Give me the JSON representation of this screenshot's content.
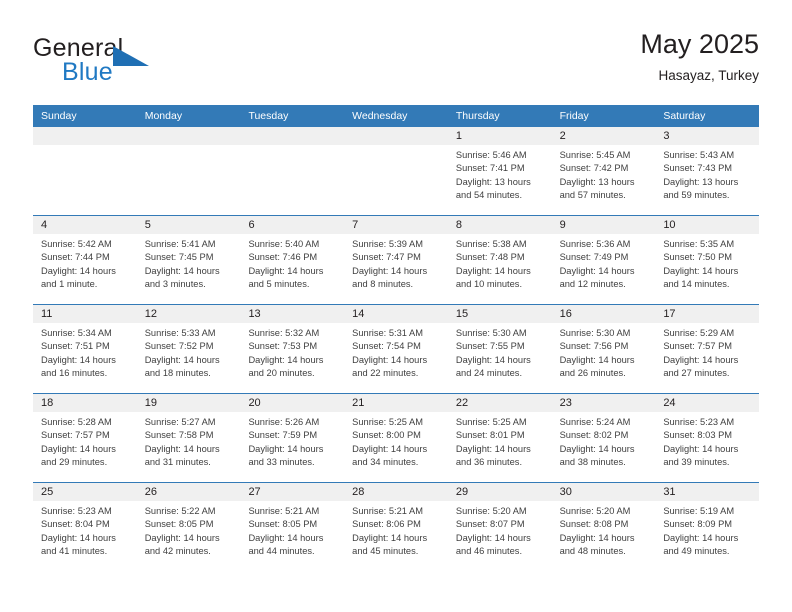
{
  "brand": {
    "name_top": "General",
    "name_bottom": "Blue",
    "flag_icon": "triangle-flag-icon",
    "accent_color": "#2079c3"
  },
  "header": {
    "title": "May 2025",
    "subtitle": "Hasayaz, Turkey"
  },
  "calendar": {
    "header_bg": "#337ab7",
    "row_rule_color": "#337ab7",
    "day_head_bg": "#f0f0f0",
    "weekdays": [
      "Sunday",
      "Monday",
      "Tuesday",
      "Wednesday",
      "Thursday",
      "Friday",
      "Saturday"
    ],
    "weeks": [
      [
        {
          "day": "",
          "empty": true
        },
        {
          "day": "",
          "empty": true
        },
        {
          "day": "",
          "empty": true
        },
        {
          "day": "",
          "empty": true
        },
        {
          "day": "1",
          "sunrise": "Sunrise: 5:46 AM",
          "sunset": "Sunset: 7:41 PM",
          "daylight": "Daylight: 13 hours and 54 minutes."
        },
        {
          "day": "2",
          "sunrise": "Sunrise: 5:45 AM",
          "sunset": "Sunset: 7:42 PM",
          "daylight": "Daylight: 13 hours and 57 minutes."
        },
        {
          "day": "3",
          "sunrise": "Sunrise: 5:43 AM",
          "sunset": "Sunset: 7:43 PM",
          "daylight": "Daylight: 13 hours and 59 minutes."
        }
      ],
      [
        {
          "day": "4",
          "sunrise": "Sunrise: 5:42 AM",
          "sunset": "Sunset: 7:44 PM",
          "daylight": "Daylight: 14 hours and 1 minute."
        },
        {
          "day": "5",
          "sunrise": "Sunrise: 5:41 AM",
          "sunset": "Sunset: 7:45 PM",
          "daylight": "Daylight: 14 hours and 3 minutes."
        },
        {
          "day": "6",
          "sunrise": "Sunrise: 5:40 AM",
          "sunset": "Sunset: 7:46 PM",
          "daylight": "Daylight: 14 hours and 5 minutes."
        },
        {
          "day": "7",
          "sunrise": "Sunrise: 5:39 AM",
          "sunset": "Sunset: 7:47 PM",
          "daylight": "Daylight: 14 hours and 8 minutes."
        },
        {
          "day": "8",
          "sunrise": "Sunrise: 5:38 AM",
          "sunset": "Sunset: 7:48 PM",
          "daylight": "Daylight: 14 hours and 10 minutes."
        },
        {
          "day": "9",
          "sunrise": "Sunrise: 5:36 AM",
          "sunset": "Sunset: 7:49 PM",
          "daylight": "Daylight: 14 hours and 12 minutes."
        },
        {
          "day": "10",
          "sunrise": "Sunrise: 5:35 AM",
          "sunset": "Sunset: 7:50 PM",
          "daylight": "Daylight: 14 hours and 14 minutes."
        }
      ],
      [
        {
          "day": "11",
          "sunrise": "Sunrise: 5:34 AM",
          "sunset": "Sunset: 7:51 PM",
          "daylight": "Daylight: 14 hours and 16 minutes."
        },
        {
          "day": "12",
          "sunrise": "Sunrise: 5:33 AM",
          "sunset": "Sunset: 7:52 PM",
          "daylight": "Daylight: 14 hours and 18 minutes."
        },
        {
          "day": "13",
          "sunrise": "Sunrise: 5:32 AM",
          "sunset": "Sunset: 7:53 PM",
          "daylight": "Daylight: 14 hours and 20 minutes."
        },
        {
          "day": "14",
          "sunrise": "Sunrise: 5:31 AM",
          "sunset": "Sunset: 7:54 PM",
          "daylight": "Daylight: 14 hours and 22 minutes."
        },
        {
          "day": "15",
          "sunrise": "Sunrise: 5:30 AM",
          "sunset": "Sunset: 7:55 PM",
          "daylight": "Daylight: 14 hours and 24 minutes."
        },
        {
          "day": "16",
          "sunrise": "Sunrise: 5:30 AM",
          "sunset": "Sunset: 7:56 PM",
          "daylight": "Daylight: 14 hours and 26 minutes."
        },
        {
          "day": "17",
          "sunrise": "Sunrise: 5:29 AM",
          "sunset": "Sunset: 7:57 PM",
          "daylight": "Daylight: 14 hours and 27 minutes."
        }
      ],
      [
        {
          "day": "18",
          "sunrise": "Sunrise: 5:28 AM",
          "sunset": "Sunset: 7:57 PM",
          "daylight": "Daylight: 14 hours and 29 minutes."
        },
        {
          "day": "19",
          "sunrise": "Sunrise: 5:27 AM",
          "sunset": "Sunset: 7:58 PM",
          "daylight": "Daylight: 14 hours and 31 minutes."
        },
        {
          "day": "20",
          "sunrise": "Sunrise: 5:26 AM",
          "sunset": "Sunset: 7:59 PM",
          "daylight": "Daylight: 14 hours and 33 minutes."
        },
        {
          "day": "21",
          "sunrise": "Sunrise: 5:25 AM",
          "sunset": "Sunset: 8:00 PM",
          "daylight": "Daylight: 14 hours and 34 minutes."
        },
        {
          "day": "22",
          "sunrise": "Sunrise: 5:25 AM",
          "sunset": "Sunset: 8:01 PM",
          "daylight": "Daylight: 14 hours and 36 minutes."
        },
        {
          "day": "23",
          "sunrise": "Sunrise: 5:24 AM",
          "sunset": "Sunset: 8:02 PM",
          "daylight": "Daylight: 14 hours and 38 minutes."
        },
        {
          "day": "24",
          "sunrise": "Sunrise: 5:23 AM",
          "sunset": "Sunset: 8:03 PM",
          "daylight": "Daylight: 14 hours and 39 minutes."
        }
      ],
      [
        {
          "day": "25",
          "sunrise": "Sunrise: 5:23 AM",
          "sunset": "Sunset: 8:04 PM",
          "daylight": "Daylight: 14 hours and 41 minutes."
        },
        {
          "day": "26",
          "sunrise": "Sunrise: 5:22 AM",
          "sunset": "Sunset: 8:05 PM",
          "daylight": "Daylight: 14 hours and 42 minutes."
        },
        {
          "day": "27",
          "sunrise": "Sunrise: 5:21 AM",
          "sunset": "Sunset: 8:05 PM",
          "daylight": "Daylight: 14 hours and 44 minutes."
        },
        {
          "day": "28",
          "sunrise": "Sunrise: 5:21 AM",
          "sunset": "Sunset: 8:06 PM",
          "daylight": "Daylight: 14 hours and 45 minutes."
        },
        {
          "day": "29",
          "sunrise": "Sunrise: 5:20 AM",
          "sunset": "Sunset: 8:07 PM",
          "daylight": "Daylight: 14 hours and 46 minutes."
        },
        {
          "day": "30",
          "sunrise": "Sunrise: 5:20 AM",
          "sunset": "Sunset: 8:08 PM",
          "daylight": "Daylight: 14 hours and 48 minutes."
        },
        {
          "day": "31",
          "sunrise": "Sunrise: 5:19 AM",
          "sunset": "Sunset: 8:09 PM",
          "daylight": "Daylight: 14 hours and 49 minutes."
        }
      ]
    ]
  }
}
